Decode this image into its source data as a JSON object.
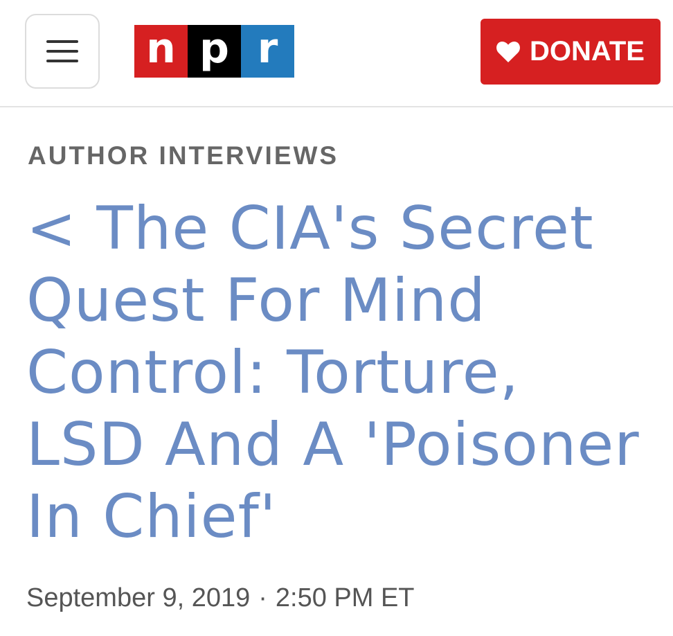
{
  "header": {
    "menu_icon": "hamburger-menu-icon",
    "logo": {
      "letters": [
        "n",
        "p",
        "r"
      ],
      "colors": [
        "#d62021",
        "#000000",
        "#237bbd"
      ]
    },
    "donate": {
      "label": "DONATE",
      "icon": "heart-icon",
      "color": "#d62021"
    }
  },
  "article": {
    "section": "AUTHOR INTERVIEWS",
    "headline": "< The CIA's Secret Quest For Mind Control: Torture, LSD And A 'Poisoner In Chief'",
    "headline_color": "#6b8cc4",
    "date": "September 9, 2019",
    "separator": "·",
    "time": "2:50 PM ET"
  }
}
